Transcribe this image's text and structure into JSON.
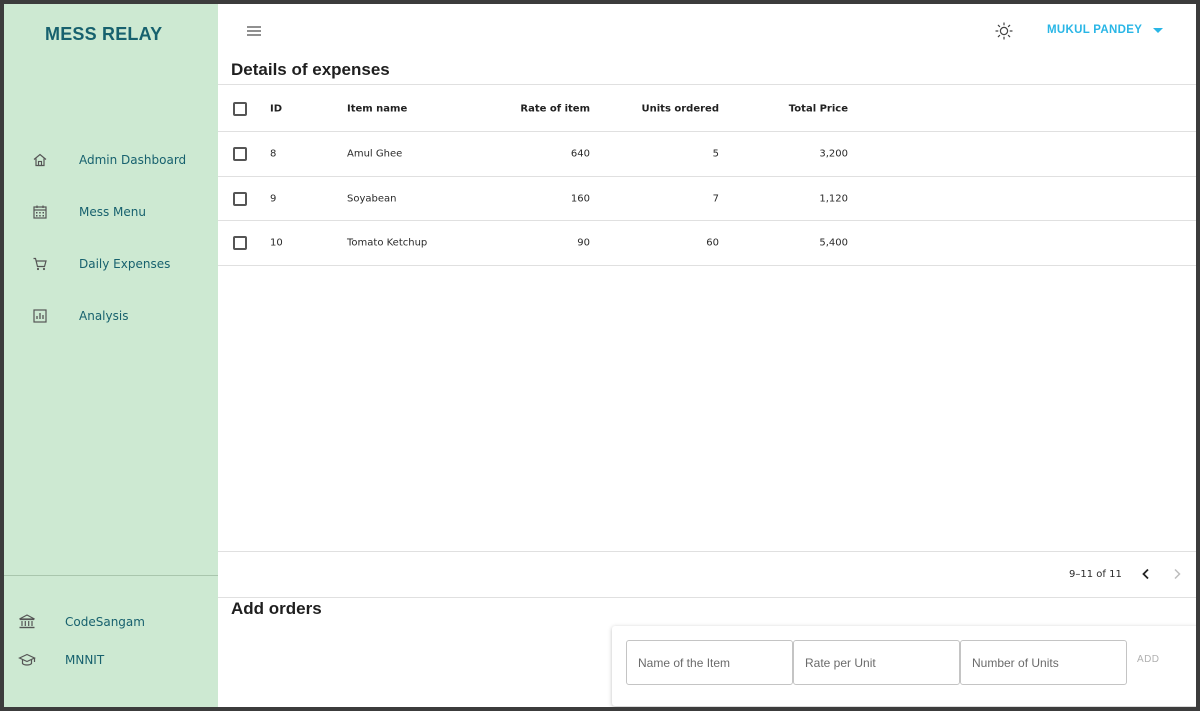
{
  "app": {
    "brand": "MESS RELAY"
  },
  "sidebar": {
    "items": [
      {
        "label": "Admin Dashboard",
        "icon": "home-icon"
      },
      {
        "label": "Mess Menu",
        "icon": "calendar-icon"
      },
      {
        "label": "Daily Expenses",
        "icon": "cart-icon"
      },
      {
        "label": "Analysis",
        "icon": "bar-chart-icon"
      }
    ],
    "footer": [
      {
        "label": "CodeSangam",
        "icon": "institution-icon"
      },
      {
        "label": "MNNIT",
        "icon": "graduation-cap-icon"
      }
    ]
  },
  "header": {
    "user_name": "MUKUL PANDEY"
  },
  "expenses": {
    "title": "Details of expenses",
    "columns": [
      "ID",
      "Item name",
      "Rate of item",
      "Units ordered",
      "Total Price"
    ],
    "rows": [
      {
        "id": "8",
        "name": "Amul Ghee",
        "rate": "640",
        "units": "5",
        "total": "3,200"
      },
      {
        "id": "9",
        "name": "Soyabean",
        "rate": "160",
        "units": "7",
        "total": "1,120"
      },
      {
        "id": "10",
        "name": "Tomato Ketchup",
        "rate": "90",
        "units": "60",
        "total": "5,400"
      }
    ],
    "pagination": "9–11 of 11"
  },
  "orders": {
    "title": "Add orders",
    "fields": {
      "item_placeholder": "Name of the Item",
      "rate_placeholder": "Rate per Unit",
      "units_placeholder": "Number of Units"
    },
    "add_label": "ADD"
  },
  "colors": {
    "sidebar_bg": "#cde9d2",
    "brand": "#17616e",
    "user_accent": "#29b6e6"
  }
}
